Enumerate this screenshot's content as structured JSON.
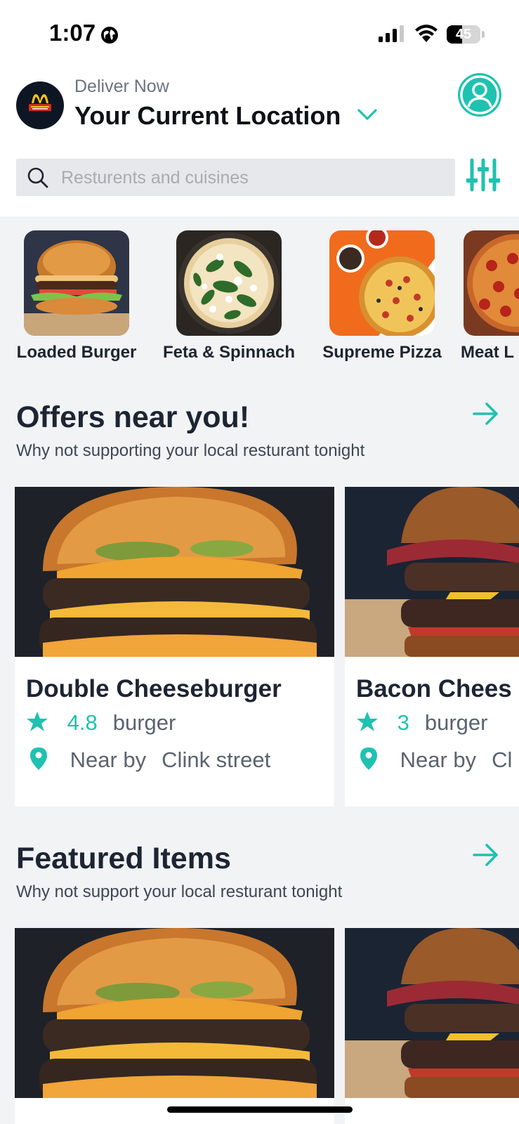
{
  "status_bar": {
    "time": "1:07",
    "battery": "45",
    "battery_level": 0.45
  },
  "header": {
    "deliver_label": "Deliver Now",
    "location": "Your Current Location"
  },
  "search": {
    "placeholder": "Resturents and cuisines"
  },
  "categories": [
    {
      "label": "Loaded Burger"
    },
    {
      "label": "Feta & Spinnach"
    },
    {
      "label": "Supreme Pizza"
    },
    {
      "label": "Meat L"
    }
  ],
  "offers": {
    "title": "Offers near you!",
    "subtitle": "Why not supporting your local resturant tonight",
    "cards": [
      {
        "title": "Double Cheeseburger",
        "rating": "4.8",
        "category": "burger",
        "near_label": "Near by",
        "street": "Clink street"
      },
      {
        "title": "Bacon Chees",
        "rating": "3",
        "category": "burger",
        "near_label": "Near by",
        "street": "Cl"
      }
    ]
  },
  "featured": {
    "title": "Featured Items",
    "subtitle": "Why not support your local resturant tonight"
  },
  "colors": {
    "accent": "#1ec2b0",
    "background": "#f2f3f5"
  }
}
